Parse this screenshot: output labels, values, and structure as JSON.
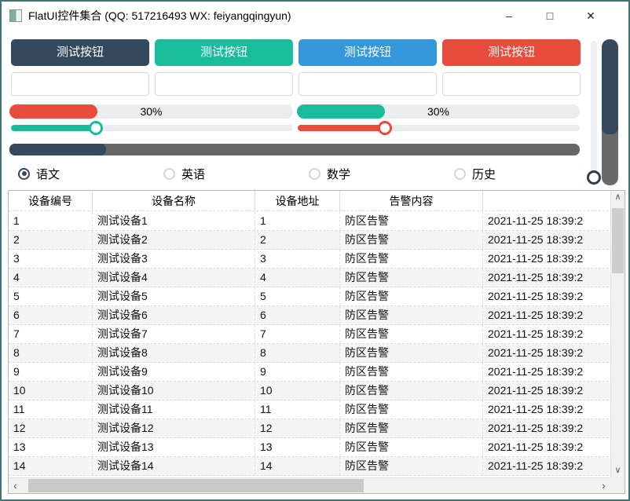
{
  "window": {
    "title": "FlatUI控件集合 (QQ: 517216493 WX: feiyangqingyun)",
    "controls": {
      "minimize": "–",
      "maximize": "□",
      "close": "✕"
    }
  },
  "colors": {
    "dark_navy": "#34495e",
    "green": "#1abc9c",
    "blue": "#3498db",
    "red": "#e74c3c",
    "track_light": "#e9edf0",
    "track_dark": "#666666",
    "window_border": "#3f7374"
  },
  "buttons": [
    {
      "label": "测试按钮",
      "color": "#34495e"
    },
    {
      "label": "测试按钮",
      "color": "#1abc9c"
    },
    {
      "label": "测试按钮",
      "color": "#3498db"
    },
    {
      "label": "测试按钮",
      "color": "#e74c3c"
    }
  ],
  "inputs": [
    {
      "value": "",
      "placeholder": ""
    },
    {
      "value": "",
      "placeholder": ""
    },
    {
      "value": "",
      "placeholder": ""
    },
    {
      "value": "",
      "placeholder": ""
    }
  ],
  "progress_bars": [
    {
      "label": "30%",
      "fill": "31%",
      "color": "#e74c3c"
    },
    {
      "label": "30%",
      "fill": "31%",
      "color": "#1abc9c"
    }
  ],
  "sliders": [
    {
      "pos": "30%",
      "color": "#1abc9c"
    },
    {
      "pos": "31%",
      "color": "#e74c3c"
    }
  ],
  "dark_bar": {
    "fill": "17%"
  },
  "vertical_slider": {
    "pos": "98%"
  },
  "vertical_progress": {
    "fill": "65%"
  },
  "radios": [
    {
      "label": "语文",
      "selected": true
    },
    {
      "label": "英语",
      "selected": false
    },
    {
      "label": "数学",
      "selected": false
    },
    {
      "label": "历史",
      "selected": false
    }
  ],
  "icons": {
    "scroll_up": "∧",
    "scroll_down": "∨",
    "scroll_left": "‹",
    "scroll_right": "›"
  },
  "table": {
    "headers": [
      "设备编号",
      "设备名称",
      "设备地址",
      "告警内容",
      ""
    ],
    "rows": [
      [
        "1",
        "测试设备1",
        "1",
        "防区告警",
        "2021-11-25 18:39:2"
      ],
      [
        "2",
        "测试设备2",
        "2",
        "防区告警",
        "2021-11-25 18:39:2"
      ],
      [
        "3",
        "测试设备3",
        "3",
        "防区告警",
        "2021-11-25 18:39:2"
      ],
      [
        "4",
        "测试设备4",
        "4",
        "防区告警",
        "2021-11-25 18:39:2"
      ],
      [
        "5",
        "测试设备5",
        "5",
        "防区告警",
        "2021-11-25 18:39:2"
      ],
      [
        "6",
        "测试设备6",
        "6",
        "防区告警",
        "2021-11-25 18:39:2"
      ],
      [
        "7",
        "测试设备7",
        "7",
        "防区告警",
        "2021-11-25 18:39:2"
      ],
      [
        "8",
        "测试设备8",
        "8",
        "防区告警",
        "2021-11-25 18:39:2"
      ],
      [
        "9",
        "测试设备9",
        "9",
        "防区告警",
        "2021-11-25 18:39:2"
      ],
      [
        "10",
        "测试设备10",
        "10",
        "防区告警",
        "2021-11-25 18:39:2"
      ],
      [
        "11",
        "测试设备11",
        "11",
        "防区告警",
        "2021-11-25 18:39:2"
      ],
      [
        "12",
        "测试设备12",
        "12",
        "防区告警",
        "2021-11-25 18:39:2"
      ],
      [
        "13",
        "测试设备13",
        "13",
        "防区告警",
        "2021-11-25 18:39:2"
      ],
      [
        "14",
        "测试设备14",
        "14",
        "防区告警",
        "2021-11-25 18:39:2"
      ]
    ]
  }
}
